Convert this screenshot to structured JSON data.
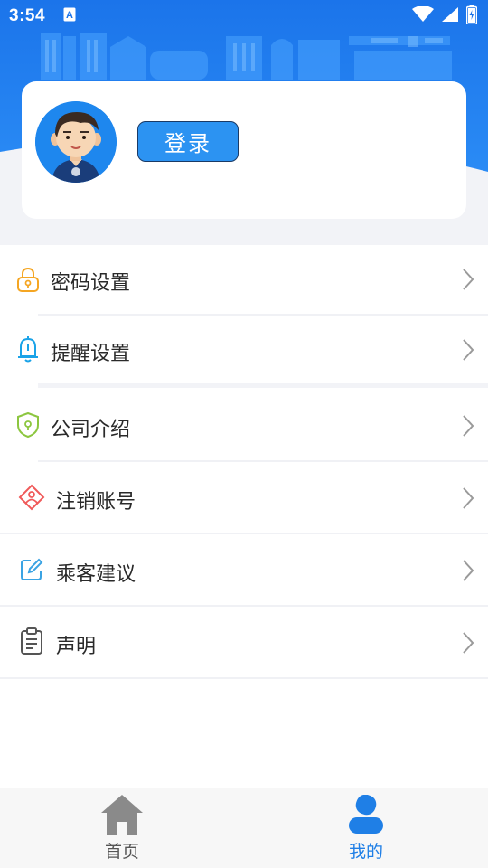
{
  "status_bar": {
    "time": "3:54",
    "icons": [
      "app-notification-icon",
      "wifi-icon",
      "cellular-signal-icon",
      "battery-icon"
    ]
  },
  "profile": {
    "login_label": "登录"
  },
  "menu": {
    "items": [
      {
        "label": "密码设置",
        "icon": "lock-icon",
        "icon_color": "#f5a623"
      },
      {
        "label": "提醒设置",
        "icon": "bell-icon",
        "icon_color": "#1aa3e8"
      },
      {
        "label": "公司介绍",
        "icon": "shield-icon",
        "icon_color": "#8cc63f"
      },
      {
        "label": "注销账号",
        "icon": "user-diamond-icon",
        "icon_color": "#f05a5a"
      },
      {
        "label": "乘客建议",
        "icon": "edit-icon",
        "icon_color": "#3aa3e3"
      },
      {
        "label": "声明",
        "icon": "clipboard-icon",
        "icon_color": "#555555"
      }
    ]
  },
  "bottom_nav": {
    "home_label": "首页",
    "mine_label": "我的",
    "active_color": "#1f7fe6",
    "inactive_color": "#555555"
  },
  "colors": {
    "brand_blue": "#1f7fe6",
    "page_bg": "#f2f3f7"
  }
}
